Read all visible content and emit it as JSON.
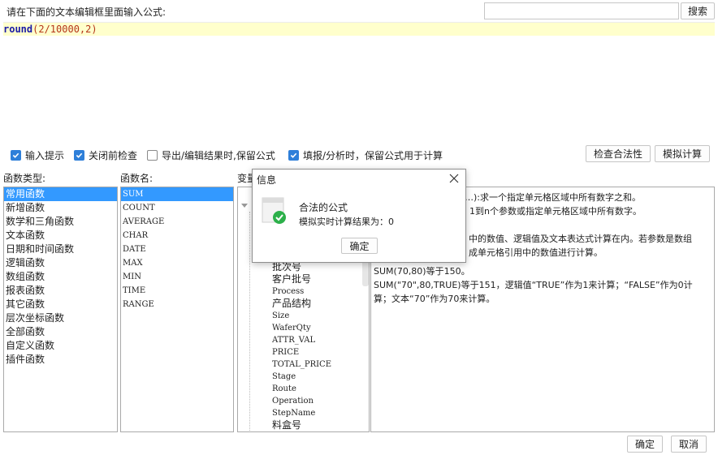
{
  "header": {
    "prompt": "请在下面的文本编辑框里面输入公式:",
    "search_placeholder": "",
    "search_label": "搜索"
  },
  "editor": {
    "formula_fn": "round",
    "formula_args": "(2/10000,2)"
  },
  "options": {
    "input_hint": "输入提示",
    "check_before_close": "关闭前检查",
    "export_keep_formula": "导出/编辑结果时,保留公式",
    "fill_keep_formula": "填报/分析时，保留公式用于计算",
    "check_validity": "检查合法性",
    "simulate_calc": "模拟计算"
  },
  "function_types": {
    "label": "函数类型:",
    "items": [
      "常用函数",
      "新增函数",
      "数学和三角函数",
      "文本函数",
      "日期和时间函数",
      "逻辑函数",
      "数组函数",
      "报表函数",
      "其它函数",
      "层次坐标函数",
      "全部函数",
      "自定义函数",
      "插件函数"
    ],
    "selected": 0
  },
  "function_names": {
    "label": "函数名:",
    "items": [
      "SUM",
      "COUNT",
      "AVERAGE",
      "CHAR",
      "DATE",
      "MAX",
      "MIN",
      "TIME",
      "RANGE"
    ],
    "selected": 0
  },
  "variables": {
    "label": "变量",
    "items": [
      "批次号",
      "客户批号",
      "Process",
      "产品结构",
      "Size",
      "WaferQty",
      "ATTR_VAL",
      "PRICE",
      "TOTAL_PRICE",
      "Stage",
      "Route",
      "Operation",
      "StepName",
      "料盒号"
    ]
  },
  "description": {
    "line1": "…):求一个指定单元格区域中所有数字之和。",
    "line2": "1到n个参数或指定单元格区域中所有数字。",
    "line3": "中的数值、逻辑值及文本表达式计算在内。若参数是数组",
    "line4": "成单元格引用中的数值进行计算。",
    "example1": "SUM(70,80)等于150。",
    "example2": "SUM(\"70\",80,TRUE)等于151，逻辑值“TRUE”作为1来计算；“FALSE”作为0计",
    "example3": "算；文本“70”作为70来计算。"
  },
  "dialog": {
    "title": "信息",
    "message": "合法的公式",
    "result": "模拟实时计算结果为：0",
    "ok": "确定"
  },
  "footer": {
    "ok": "确定",
    "cancel": "取消"
  },
  "colors": {
    "accent": "#3399ff",
    "editor_line": "#ffffcc",
    "keyword": "#1a1aa6",
    "number": "#b5361a",
    "success": "#2cb04a"
  }
}
